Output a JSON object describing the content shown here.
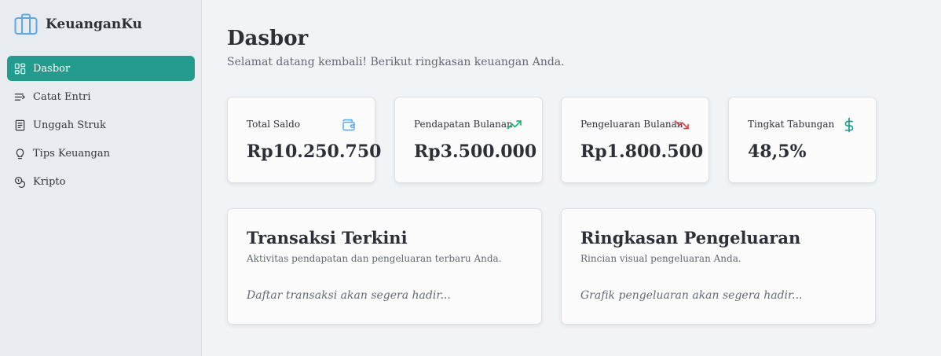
{
  "brand": {
    "name": "KeuanganKu",
    "icon": "briefcase-icon"
  },
  "sidebar": {
    "items": [
      {
        "label": "Dasbor",
        "icon": "dashboard-grid-icon",
        "active": true
      },
      {
        "label": "Catat Entri",
        "icon": "list-add-icon",
        "active": false
      },
      {
        "label": "Unggah Struk",
        "icon": "receipt-icon",
        "active": false
      },
      {
        "label": "Tips Keuangan",
        "icon": "lightbulb-icon",
        "active": false
      },
      {
        "label": "Kripto",
        "icon": "coins-icon",
        "active": false
      }
    ]
  },
  "page": {
    "title": "Dasbor",
    "subtitle": "Selamat datang kembali! Berikut ringkasan keuangan Anda."
  },
  "stats": [
    {
      "label": "Total Saldo",
      "value": "Rp10.250.750",
      "icon": "wallet-icon"
    },
    {
      "label": "Pendapatan Bulanan",
      "value": "Rp3.500.000",
      "icon": "trending-up-icon"
    },
    {
      "label": "Pengeluaran Bulanan",
      "value": "Rp1.800.500",
      "icon": "trending-down-icon"
    },
    {
      "label": "Tingkat Tabungan",
      "value": "48,5%",
      "icon": "dollar-icon"
    }
  ],
  "panels": {
    "transactions": {
      "title": "Transaksi Terkini",
      "subtitle": "Aktivitas pendapatan dan pengeluaran terbaru Anda.",
      "placeholder": "Daftar transaksi akan segera hadir..."
    },
    "spending": {
      "title": "Ringkasan Pengeluaran",
      "subtitle": "Rincian visual pengeluaran Anda.",
      "placeholder": "Grafik pengeluaran akan segera hadir..."
    }
  },
  "colors": {
    "accent": "#249c8d",
    "up": "#22b573",
    "down": "#e04848",
    "wallet": "#5aa9e6",
    "dollar": "#249c8d"
  }
}
